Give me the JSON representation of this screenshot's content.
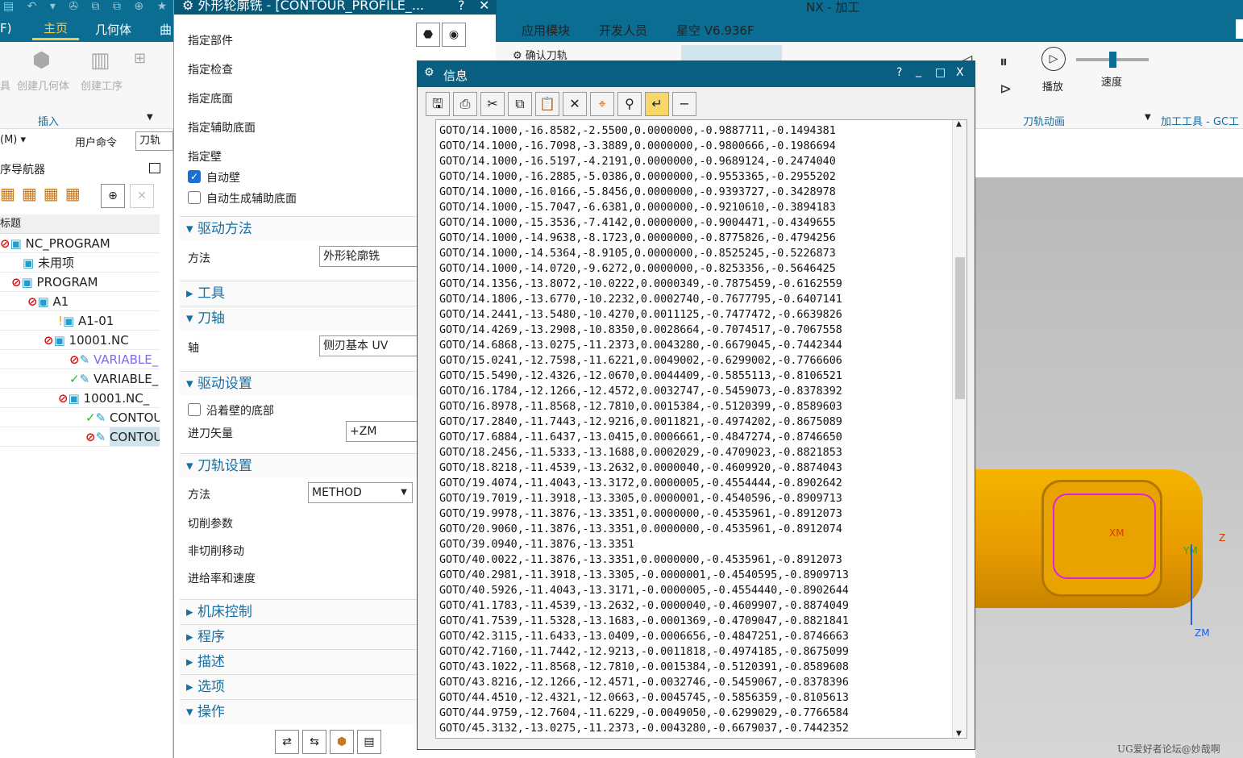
{
  "quick_access": "▤ ↶ ▾ ✇ ⧉ ⧉ ⊕ ★ ▾",
  "ribbon_tabs": {
    "partial": "F)",
    "home": "主页",
    "geometry": "几何体",
    "curve": "曲",
    "app_module": "应用模块",
    "developer": "开发人员",
    "xingkong": "星空 V6.936F"
  },
  "main_title": "NX - 加工",
  "ribbon": {
    "tool_partial": "具",
    "create_geometry": "创建几何体",
    "create_operation": "创建工序",
    "insert_group": "插入",
    "confirm_toolpath": "确认刀轨",
    "play": "播放",
    "speed": "速度",
    "speed_value": 0.5,
    "toolpath_anim": "刀轨动画",
    "machining_tools": "加工工具 - GC工",
    "menu": "(M)",
    "user_command": "用户命令",
    "toolpath_field": "刀轨"
  },
  "navigator": {
    "title": "序导航器",
    "column": "标题",
    "rows": [
      {
        "status": "no",
        "icon": "folder",
        "label": "NC_PROGRAM"
      },
      {
        "status": "",
        "icon": "folder",
        "label": "未用项"
      },
      {
        "status": "no",
        "icon": "folder",
        "label": "PROGRAM"
      },
      {
        "status": "no",
        "icon": "folder",
        "label": "A1"
      },
      {
        "status": "warn",
        "icon": "folder",
        "label": "A1-01"
      },
      {
        "status": "no",
        "icon": "folder",
        "label": "10001.NC"
      },
      {
        "status": "no",
        "icon": "op",
        "label": "VARIABLE_"
      },
      {
        "status": "ok",
        "icon": "op",
        "label": "VARIABLE_"
      },
      {
        "status": "no",
        "icon": "folder",
        "label": "10001.NC_"
      },
      {
        "status": "ok",
        "icon": "op",
        "label": "CONTOU"
      },
      {
        "status": "no",
        "icon": "op",
        "label": "CONTOU"
      }
    ]
  },
  "op_dialog": {
    "title": "外形轮廓铣 - [CONTOUR_PROFILE_...",
    "specify_part": "指定部件",
    "specify_check": "指定检查",
    "specify_floor": "指定底面",
    "specify_aux_floor": "指定辅助底面",
    "specify_wall": "指定壁",
    "auto_wall": "自动壁",
    "auto_wall_checked": true,
    "auto_aux_floor": "自动生成辅助底面",
    "auto_aux_floor_checked": false,
    "drive_method": "驱动方法",
    "method_label": "方法",
    "method_value": "外形轮廓铣",
    "tool": "工具",
    "tool_axis": "刀轴",
    "axis_label": "轴",
    "axis_value": "侧刃基本 UV",
    "drive_settings": "驱动设置",
    "along_wall_bottom": "沿着壁的底部",
    "along_wall_bottom_checked": false,
    "entry_vector_label": "进刀矢量",
    "entry_vector_value": "+ZM",
    "path_settings": "刀轨设置",
    "path_method_label": "方法",
    "path_method_value": "METHOD",
    "cut_params": "切削参数",
    "non_cut_moves": "非切削移动",
    "feeds_speeds": "进给率和速度",
    "machine_control": "机床控制",
    "program": "程序",
    "description": "描述",
    "options": "选项",
    "actions": "操作"
  },
  "info_dialog": {
    "title": "信息",
    "help": "?",
    "minimize": "_",
    "maximize": "□",
    "close": "X",
    "toolbar": [
      "save-icon",
      "print-icon",
      "cut-icon",
      "copy-icon",
      "paste-icon",
      "delete-icon",
      "locate-icon",
      "find-icon",
      "wrap-icon",
      "minus-icon"
    ],
    "lines": [
      "GOTO/14.1000,-16.8582,-2.5500,0.0000000,-0.9887711,-0.1494381",
      "GOTO/14.1000,-16.7098,-3.3889,0.0000000,-0.9800666,-0.1986694",
      "GOTO/14.1000,-16.5197,-4.2191,0.0000000,-0.9689124,-0.2474040",
      "GOTO/14.1000,-16.2885,-5.0386,0.0000000,-0.9553365,-0.2955202",
      "GOTO/14.1000,-16.0166,-5.8456,0.0000000,-0.9393727,-0.3428978",
      "GOTO/14.1000,-15.7047,-6.6381,0.0000000,-0.9210610,-0.3894183",
      "GOTO/14.1000,-15.3536,-7.4142,0.0000000,-0.9004471,-0.4349655",
      "GOTO/14.1000,-14.9638,-8.1723,0.0000000,-0.8775826,-0.4794256",
      "GOTO/14.1000,-14.5364,-8.9105,0.0000000,-0.8525245,-0.5226873",
      "GOTO/14.1000,-14.0720,-9.6272,0.0000000,-0.8253356,-0.5646425",
      "GOTO/14.1356,-13.8072,-10.0222,0.0000349,-0.7875459,-0.6162559",
      "GOTO/14.1806,-13.6770,-10.2232,0.0002740,-0.7677795,-0.6407141",
      "GOTO/14.2441,-13.5480,-10.4270,0.0011125,-0.7477472,-0.6639826",
      "GOTO/14.4269,-13.2908,-10.8350,0.0028664,-0.7074517,-0.7067558",
      "GOTO/14.6868,-13.0275,-11.2373,0.0043280,-0.6679045,-0.7442344",
      "GOTO/15.0241,-12.7598,-11.6221,0.0049002,-0.6299002,-0.7766606",
      "GOTO/15.5490,-12.4326,-12.0670,0.0044409,-0.5855113,-0.8106521",
      "GOTO/16.1784,-12.1266,-12.4572,0.0032747,-0.5459073,-0.8378392",
      "GOTO/16.8978,-11.8568,-12.7810,0.0015384,-0.5120399,-0.8589603",
      "GOTO/17.2840,-11.7443,-12.9216,0.0011821,-0.4974202,-0.8675089",
      "GOTO/17.6884,-11.6437,-13.0415,0.0006661,-0.4847274,-0.8746650",
      "GOTO/18.2456,-11.5333,-13.1688,0.0002029,-0.4709023,-0.8821853",
      "GOTO/18.8218,-11.4539,-13.2632,0.0000040,-0.4609920,-0.8874043",
      "GOTO/19.4074,-11.4043,-13.3172,0.0000005,-0.4554444,-0.8902642",
      "GOTO/19.7019,-11.3918,-13.3305,0.0000001,-0.4540596,-0.8909713",
      "GOTO/19.9978,-11.3876,-13.3351,0.0000000,-0.4535961,-0.8912073",
      "GOTO/20.9060,-11.3876,-13.3351,0.0000000,-0.4535961,-0.8912074",
      "GOTO/39.0940,-11.3876,-13.3351",
      "GOTO/40.0022,-11.3876,-13.3351,0.0000000,-0.4535961,-0.8912073",
      "GOTO/40.2981,-11.3918,-13.3305,-0.0000001,-0.4540595,-0.8909713",
      "GOTO/40.5926,-11.4043,-13.3171,-0.0000005,-0.4554440,-0.8902644",
      "GOTO/41.1783,-11.4539,-13.2632,-0.0000040,-0.4609907,-0.8874049",
      "GOTO/41.7539,-11.5328,-13.1683,-0.0001369,-0.4709047,-0.8821841",
      "GOTO/42.3115,-11.6433,-13.0409,-0.0006656,-0.4847251,-0.8746663",
      "GOTO/42.7160,-11.7442,-12.9213,-0.0011818,-0.4974185,-0.8675099",
      "GOTO/43.1022,-11.8568,-12.7810,-0.0015384,-0.5120391,-0.8589608",
      "GOTO/43.8216,-12.1266,-12.4571,-0.0032746,-0.5459067,-0.8378396",
      "GOTO/44.4510,-12.4321,-12.0663,-0.0045745,-0.5856359,-0.8105613",
      "GOTO/44.9759,-12.7604,-11.6229,-0.0049050,-0.6299029,-0.7766584",
      "GOTO/45.3132,-13.0275,-11.2373,-0.0043280,-0.6679037,-0.7442352"
    ]
  },
  "viewport": {
    "xm": "XM",
    "ym": "YM",
    "zm": "ZM",
    "z": "Z",
    "part_color": "#f0a000"
  },
  "watermark": "UG爱好者论坛@妙哉啊"
}
